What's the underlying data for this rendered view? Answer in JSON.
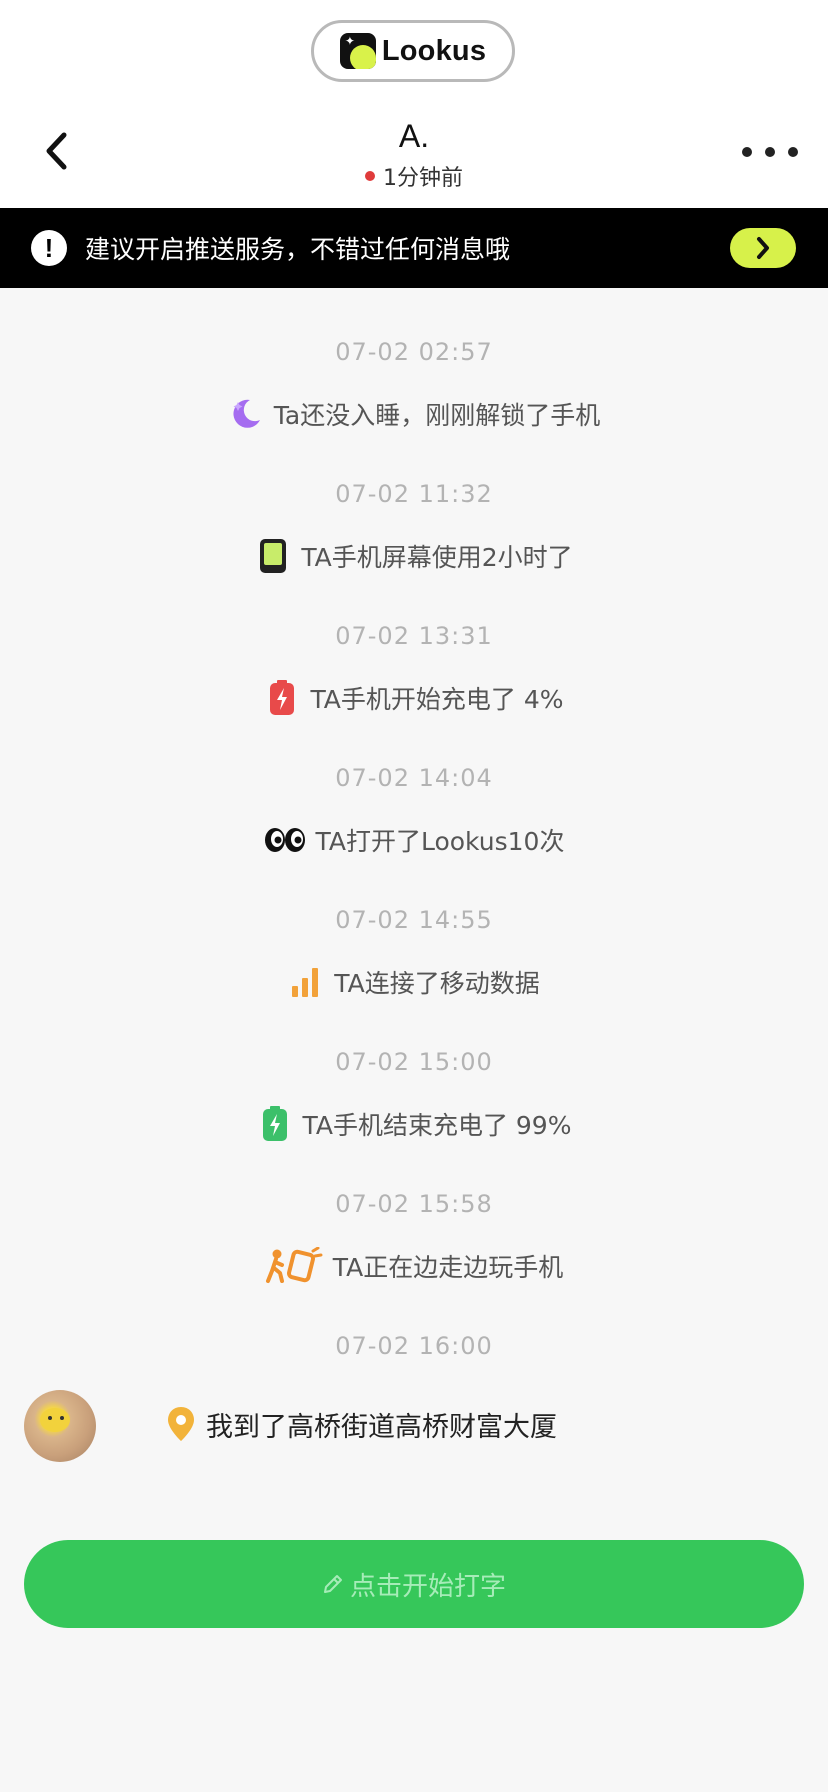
{
  "brand": {
    "name": "Lookus"
  },
  "header": {
    "title": "A.",
    "status_text": "1分钟前",
    "status_color": "#e03b3b"
  },
  "banner": {
    "text": "建议开启推送服务，不错过任何消息哦",
    "icon": "exclamation-icon",
    "accent": "#d7f14a"
  },
  "feed": {
    "items": [
      {
        "time": "07-02 02:57",
        "icon": "moon-icon",
        "text": "Ta还没入睡，刚刚解锁了手机"
      },
      {
        "time": "07-02 11:32",
        "icon": "phone-screen-icon",
        "text": "TA手机屏幕使用2小时了"
      },
      {
        "time": "07-02 13:31",
        "icon": "battery-charging-red-icon",
        "text": "TA手机开始充电了 4%"
      },
      {
        "time": "07-02 14:04",
        "icon": "eyes-icon",
        "text": "TA打开了Lookus10次"
      },
      {
        "time": "07-02 14:55",
        "icon": "signal-bars-icon",
        "text": "TA连接了移动数据"
      },
      {
        "time": "07-02 15:00",
        "icon": "battery-charging-green-icon",
        "text": "TA手机结束充电了 99%"
      },
      {
        "time": "07-02 15:58",
        "icon": "walking-phone-icon",
        "text": "TA正在边走边玩手机"
      }
    ],
    "last_time": "07-02 16:00"
  },
  "message": {
    "icon": "location-pin-icon",
    "text": "我到了高桥街道高桥财富大厦"
  },
  "composer": {
    "label": "点击开始打字",
    "color": "#36c75a"
  }
}
